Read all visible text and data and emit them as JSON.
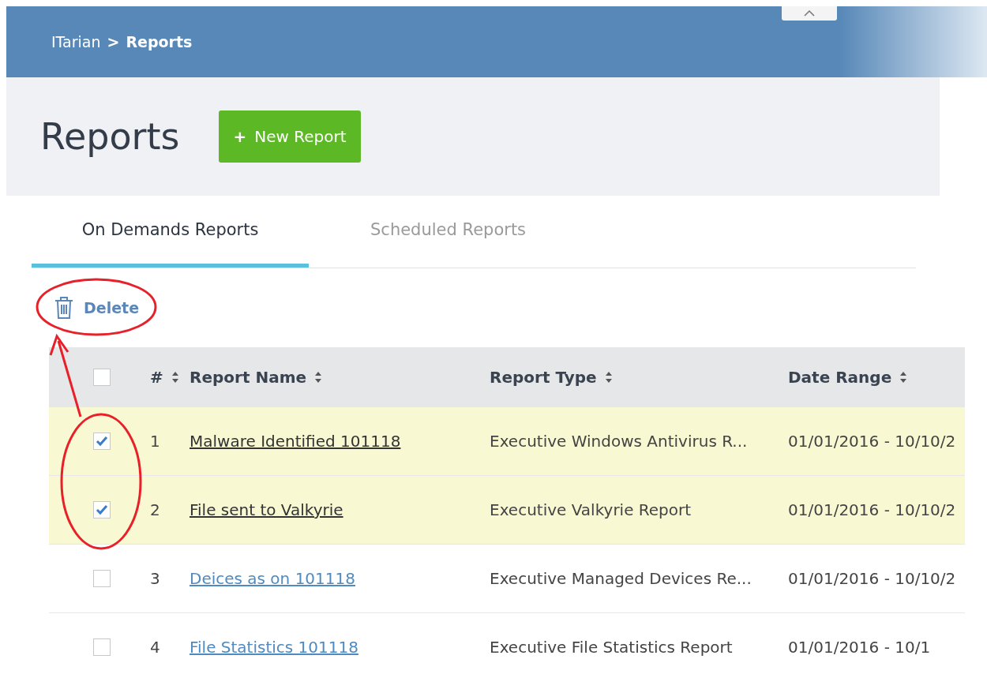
{
  "breadcrumb": {
    "root": "ITarian",
    "separator": ">",
    "current": "Reports"
  },
  "page_title": "Reports",
  "new_button": {
    "icon": "+",
    "label": "New Report"
  },
  "tabs": [
    {
      "label": "On Demands Reports",
      "selected": true
    },
    {
      "label": "Scheduled Reports",
      "selected": false
    }
  ],
  "toolbar": {
    "delete_label": "Delete"
  },
  "table": {
    "select_all": false,
    "columns": [
      {
        "label": "#"
      },
      {
        "label": "Report Name"
      },
      {
        "label": "Report Type"
      },
      {
        "label": "Date Range"
      }
    ],
    "rows": [
      {
        "selected": true,
        "number": "1",
        "name": "Malware Identified 101118",
        "visited": true,
        "type": "Executive Windows Antivirus R...",
        "date_range": "01/01/2016 - 10/10/2"
      },
      {
        "selected": true,
        "number": "2",
        "name": "File sent to Valkyrie",
        "visited": true,
        "type": "Executive Valkyrie Report",
        "date_range": "01/01/2016 - 10/10/2"
      },
      {
        "selected": false,
        "number": "3",
        "name": "Deices as on 101118",
        "visited": false,
        "type": "Executive Managed Devices Re...",
        "date_range": "01/01/2016 - 10/10/2"
      },
      {
        "selected": false,
        "number": "4",
        "name": "File Statistics 101118",
        "visited": false,
        "type": "Executive File Statistics Report",
        "date_range": "01/01/2016 - 10/1"
      }
    ]
  }
}
